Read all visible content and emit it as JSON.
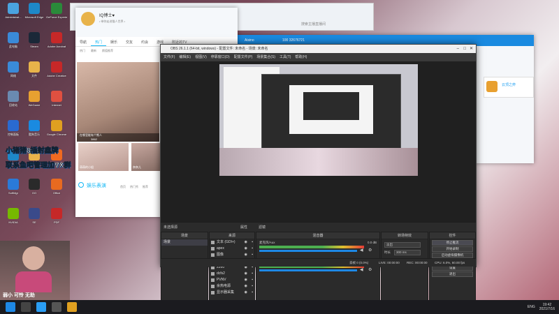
{
  "desktop_icons": [
    {
      "label": "Administrat...",
      "color": "#4aa3df"
    },
    {
      "label": "Microsoft Edge",
      "color": "#1e88c8"
    },
    {
      "label": "GeForce Experience",
      "color": "#2a8a3a"
    },
    {
      "label": "此电脑",
      "color": "#3a8ad8"
    },
    {
      "label": "Steam",
      "color": "#1b2838"
    },
    {
      "label": "Adobe Acrobat",
      "color": "#c62828"
    },
    {
      "label": "网络",
      "color": "#3a8ad8"
    },
    {
      "label": "文件",
      "color": "#e8b34a"
    },
    {
      "label": "Adobe Creative",
      "color": "#c62828"
    },
    {
      "label": "回收站",
      "color": "#6a8ab0"
    },
    {
      "label": "WeGame",
      "color": "#e8a030"
    },
    {
      "label": "Internet",
      "color": "#e05040"
    },
    {
      "label": "控制面板",
      "color": "#2a6ad0"
    },
    {
      "label": "酷狗音乐",
      "color": "#1a8ae0"
    },
    {
      "label": "Google Chrome",
      "color": "#e0a020"
    },
    {
      "label": "Edge",
      "color": "#1e88c8"
    },
    {
      "label": "百度网盘",
      "color": "#e8b34a"
    },
    {
      "label": "腾讯视频",
      "color": "#f06a20"
    },
    {
      "label": "SoftMgr",
      "color": "#2a7ad8"
    },
    {
      "label": "GO",
      "color": "#2a2a2a"
    },
    {
      "label": "Office",
      "color": "#e86a20"
    },
    {
      "label": "NVIDIA",
      "color": "#76b900"
    },
    {
      "label": "SE",
      "color": "#3a4a8a"
    },
    {
      "label": "PDF",
      "color": "#c62828"
    }
  ],
  "overlay_text": {
    "line1": "小猪猪8插射鑫牌",
    "line2": "联系鱼吧管理加VX群"
  },
  "webcam_caption": "弱小 可怜 无助",
  "qq": {
    "name": "IQ博士♥",
    "signature": "• 带你走进猫人世界 •",
    "tabs": [
      "导航",
      "热门",
      "娱乐",
      "交友",
      "约会",
      "游戏",
      "附近的TV"
    ],
    "active_tab": 1,
    "sub_tabs": [
      "热门",
      "最新",
      "颜值推荐"
    ],
    "card1_caption": "在哪里能有个熊人",
    "card1_count": "3862",
    "card2_caption": "萌萌的小姐",
    "card3_caption": "奈奈儿",
    "section_title": "娱乐表演",
    "section_links": [
      "首页",
      "热门秀",
      "推荐"
    ]
  },
  "back_window": {
    "title": "Aisino",
    "id": "100 32676721",
    "search_placeholder": "搜索主播直播间",
    "badge": "云顶之弈"
  },
  "obs": {
    "title": "OBS 26.1.1 (64-bit, windows) - 配置文件: 未命名 - 场景: 未命名",
    "menu": [
      "文件(F)",
      "编辑(E)",
      "视图(V)",
      "停靠窗口(D)",
      "配置文件(P)",
      "场景集合(S)",
      "工具(T)",
      "帮助(H)"
    ],
    "no_source": "未选择源",
    "properties": "属性",
    "filters": "滤镜",
    "docks": {
      "scenes": "场景",
      "sources": "来源",
      "mixer": "混音器",
      "transitions": "转场特效",
      "controls": "控件"
    },
    "scene_items": [
      "场景"
    ],
    "source_items": [
      "文本 (GDI+)",
      "apex",
      "图像",
      "视频采集设备",
      "2260",
      "dcfs2",
      "PVNV",
      "余热电源",
      "显示器采集"
    ],
    "mixer": [
      {
        "name": "麦克风/Aux",
        "level": "0.0 dB"
      },
      {
        "name": "桌面音频",
        "level": "0.0 dB"
      }
    ],
    "transition": {
      "type": "淡出",
      "duration_label": "时长",
      "duration": "300 ms"
    },
    "controls": [
      "停止推流",
      "开始录制",
      "启动虚拟摄像机",
      "工作室模式",
      "设置",
      "退出"
    ],
    "status": {
      "live": "LIVE: 00:00:00",
      "rec": "REC: 00:00:00",
      "cpu": "CPU: 6.0%, 60.00 fps",
      "dropped": "丢帧 0 (0.0%)"
    }
  },
  "taskbar": {
    "time": "19:42",
    "date": "2021/7/16",
    "lang": "ENG"
  }
}
